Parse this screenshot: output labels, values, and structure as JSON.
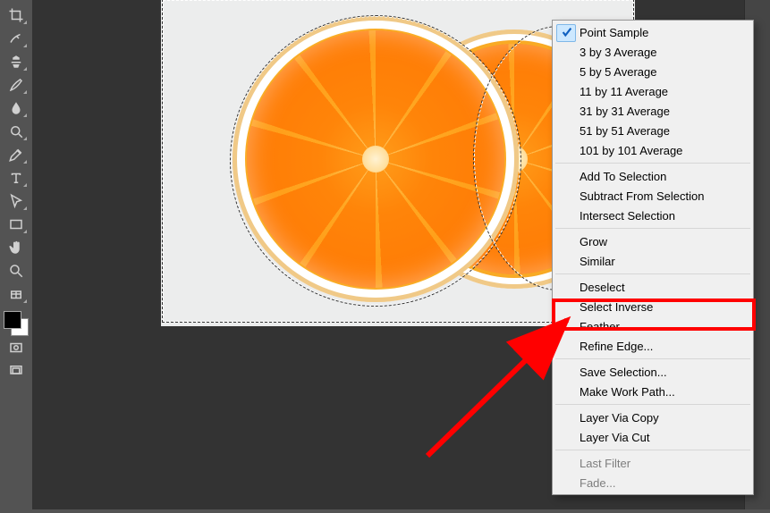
{
  "toolbar": {
    "tools": [
      "crop-tool",
      "healing-brush-tool",
      "clone-stamp-tool",
      "brush-tool",
      "blur-tool",
      "dodge-tool",
      "pen-tool",
      "type-tool",
      "path-selection-tool",
      "rectangle-shape-tool",
      "hand-tool",
      "zoom-tool",
      "color-picker-tool"
    ]
  },
  "context_menu": {
    "groups": [
      [
        {
          "label": "Point Sample",
          "checked": true
        },
        {
          "label": "3 by 3 Average"
        },
        {
          "label": "5 by 5 Average"
        },
        {
          "label": "11 by 11 Average"
        },
        {
          "label": "31 by 31 Average"
        },
        {
          "label": "51 by 51 Average"
        },
        {
          "label": "101 by 101 Average"
        }
      ],
      [
        {
          "label": "Add To Selection"
        },
        {
          "label": "Subtract From Selection"
        },
        {
          "label": "Intersect Selection"
        }
      ],
      [
        {
          "label": "Grow"
        },
        {
          "label": "Similar"
        }
      ],
      [
        {
          "label": "Deselect"
        },
        {
          "label": "Select Inverse",
          "highlighted": true
        },
        {
          "label": "Feather..."
        },
        {
          "label": "Refine Edge..."
        }
      ],
      [
        {
          "label": "Save Selection..."
        },
        {
          "label": "Make Work Path..."
        }
      ],
      [
        {
          "label": "Layer Via Copy"
        },
        {
          "label": "Layer Via Cut"
        }
      ],
      [
        {
          "label": "Last Filter",
          "disabled": true
        },
        {
          "label": "Fade...",
          "disabled": true
        }
      ]
    ]
  },
  "annotation": {
    "highlight_target": "Select Inverse",
    "arrow_color": "#ff0000"
  }
}
